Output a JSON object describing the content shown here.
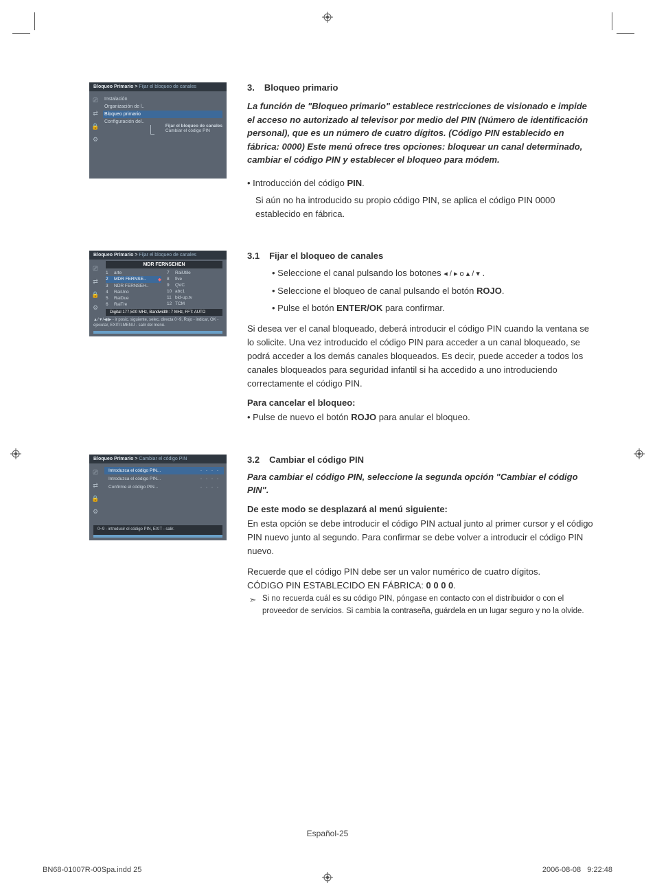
{
  "section3": {
    "num": "3.",
    "title": "Bloqueo primario",
    "intro": "La función de \"Bloqueo primario\" establece restricciones de visionado e impide el acceso no autorizado al televisor por medio del PIN (Número de identificación personal), que es un número de cuatro dígitos. (Código PIN establecido en fábrica: 0000) Este menú ofrece tres opciones: bloquear un canal determinado, cambiar el código PIN y establecer el bloqueo para módem.",
    "bullet_pre": "• Introducción del código ",
    "bullet_bold": "PIN",
    "bullet_post": ".",
    "bullet_line2": "Si aún no ha introducido su propio código PIN, se aplica el código PIN 0000 establecido en fábrica."
  },
  "section31": {
    "num": "3.1",
    "title": "Fijar el bloqueo de canales",
    "b1_pre": "• Seleccione el canal pulsando los botones  ",
    "b1_nav": "◂ / ▸  o  ▴ / ▾",
    "b1_post": " .",
    "b2_pre": "• Seleccione el bloqueo de canal pulsando el botón ",
    "b2_bold": "ROJO",
    "b2_post": ".",
    "b3_pre": "• Pulse el botón ",
    "b3_bold": "ENTER/OK",
    "b3_post": " para confirmar.",
    "para": "Si desea ver el canal bloqueado, deberá introducir el código PIN cuando la ventana se lo solicite. Una vez introducido el código PIN para acceder a un canal bloqueado, se podrá acceder a los demás canales bloqueados. Es decir, puede acceder a todos los canales bloqueados para seguridad infantil si ha accedido a uno introduciendo correctamente el código PIN.",
    "cancel_head": "Para cancelar el bloqueo:",
    "cancel_pre": "• Pulse de nuevo el botón ",
    "cancel_bold": "ROJO",
    "cancel_post": " para anular el bloqueo."
  },
  "section32": {
    "num": "3.2",
    "title": "Cambiar el código PIN",
    "intro": "Para cambiar el código PIN, seleccione la segunda opción \"Cambiar el código PIN\".",
    "subhead": "De este modo se desplazará al menú siguiente:",
    "para1": "En esta opción se debe introducir el código PIN actual junto al primer cursor y el código PIN nuevo junto al segundo. Para confirmar se debe volver a introducir el código PIN nuevo.",
    "para2_pre": "Recuerde que el código PIN debe ser un valor numérico de cuatro dígitos.",
    "para3_pre": "CÓDIGO PIN ESTABLECIDO EN FÁBRICA: ",
    "para3_bold": "0 0 0 0",
    "para3_post": ".",
    "note": "Si no recuerda cuál es su código PIN, póngase en contacto con el distribuidor o con el proveedor de servicios. Si cambia la contraseña, guárdela en un lugar seguro y no la olvide."
  },
  "screenshot1": {
    "breadcrumb_a": "Bloqueo Primario > ",
    "breadcrumb_b": "Fijar el bloqueo de canales",
    "menu": [
      "Instalación",
      "Organización de l..",
      "Bloqueo primario",
      "Configuración del.."
    ],
    "submenu": [
      "Fijar el bloqueo de canales",
      "Cambiar el código PIN"
    ]
  },
  "screenshot2": {
    "breadcrumb_a": "Bloqueo Primario > ",
    "breadcrumb_b": "Fijar el bloqueo de canales",
    "title": "MDR FERNSEHEN",
    "left": [
      {
        "n": "1",
        "name": "arte"
      },
      {
        "n": "2",
        "name": "MDR FERNSE..",
        "sel": true,
        "dot": true
      },
      {
        "n": "3",
        "name": "NDR FERNSEH.."
      },
      {
        "n": "4",
        "name": "RaiUno"
      },
      {
        "n": "5",
        "name": "RaiDue"
      },
      {
        "n": "6",
        "name": "RaiTre"
      }
    ],
    "right": [
      {
        "n": "7",
        "name": "RaiUtile"
      },
      {
        "n": "8",
        "name": "five"
      },
      {
        "n": "9",
        "name": "QVC"
      },
      {
        "n": "10",
        "name": "abc1"
      },
      {
        "n": "11",
        "name": "bid-up.tv"
      },
      {
        "n": "12",
        "name": "TCM"
      }
    ],
    "info": "Digital 177,500 MHz, Bandwidth: 7 MHz, FFT: AUTO",
    "footer": "▲/▼/◀/▶ - ir posic. siguiente, selec. directa 0~9, Rojo - indicar, OK - ejecutar, EXIT/I.MENU - salir del menú."
  },
  "screenshot3": {
    "breadcrumb_a": "Bloqueo Primario > ",
    "breadcrumb_b": "Cambiar el código PIN",
    "rows": [
      {
        "label": "Introduzca el código PIN...",
        "dots": "- - - -",
        "hl": true
      },
      {
        "label": "Introduzca el código PIN...",
        "dots": "- - - -"
      },
      {
        "label": "Confirme el código PIN...",
        "dots": "- - - -"
      }
    ],
    "footer": "0~9 - introducir el código PIN, EXIT - salir."
  },
  "page_label": "Español-25",
  "footer_left": "BN68-01007R-00Spa.indd   25",
  "footer_right_date": "2006-08-08",
  "footer_right_time": "9:22:48"
}
